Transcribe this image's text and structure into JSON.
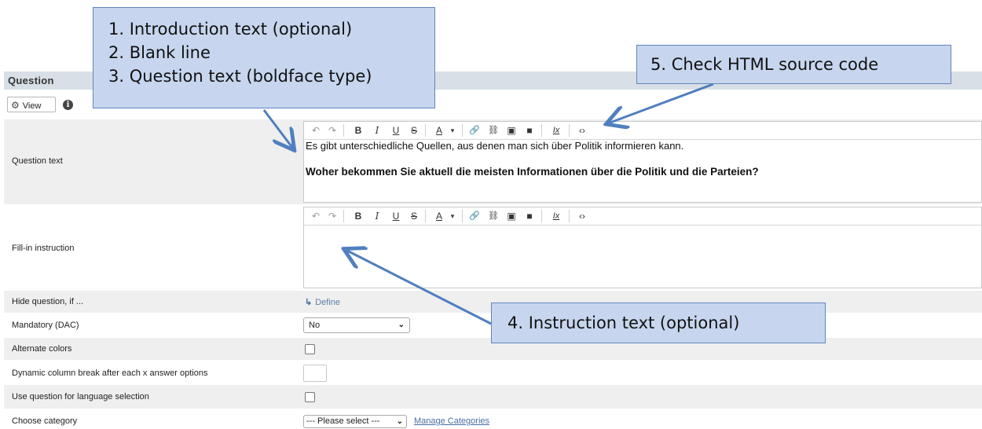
{
  "section": {
    "title": "Question"
  },
  "view_button": {
    "label": "View",
    "icon": "gear-icon"
  },
  "info_icon": {
    "glyph": "i"
  },
  "question_text": {
    "label": "Question text",
    "intro": "Es gibt unterschiedliche Quellen, aus denen man sich über Politik informieren kann.",
    "question": "Woher bekommen Sie aktuell die meisten Informationen über die Politik und die Parteien?"
  },
  "toolbar": {
    "undo": "↶",
    "redo": "↷",
    "bold": "B",
    "italic": "I",
    "underline": "U",
    "strike": "S",
    "text_color": "A",
    "dropdown": "▾",
    "link": "🔗",
    "unlink": "⛓",
    "image": "▣",
    "block": "■",
    "clear_format": "Ix",
    "source": "‹›"
  },
  "fill_in": {
    "label": "Fill-in instruction",
    "value": ""
  },
  "hide_question": {
    "label": "Hide question, if ...",
    "define": "Define"
  },
  "mandatory": {
    "label": "Mandatory (DAC)",
    "value": "No"
  },
  "alternate_colors": {
    "label": "Alternate colors",
    "checked": false
  },
  "column_break": {
    "label": "Dynamic column break after each x answer options",
    "value": ""
  },
  "language_selection": {
    "label": "Use question for language selection",
    "checked": false
  },
  "category": {
    "label": "Choose category",
    "value": "--- Please select ---",
    "manage_link": "Manage Categories"
  },
  "callouts": {
    "intro_lines": [
      "1. Introduction text (optional)",
      "2. Blank line",
      "3. Question text (boldface type)"
    ],
    "instruction": "4. Instruction text (optional)",
    "source": "5. Check HTML source code"
  },
  "colors": {
    "callout_fill": "#c7d6ee",
    "callout_border": "#5f86be",
    "arrow": "#4f7fbf",
    "header": "#d9dfe6",
    "row_gray": "#efefef"
  }
}
